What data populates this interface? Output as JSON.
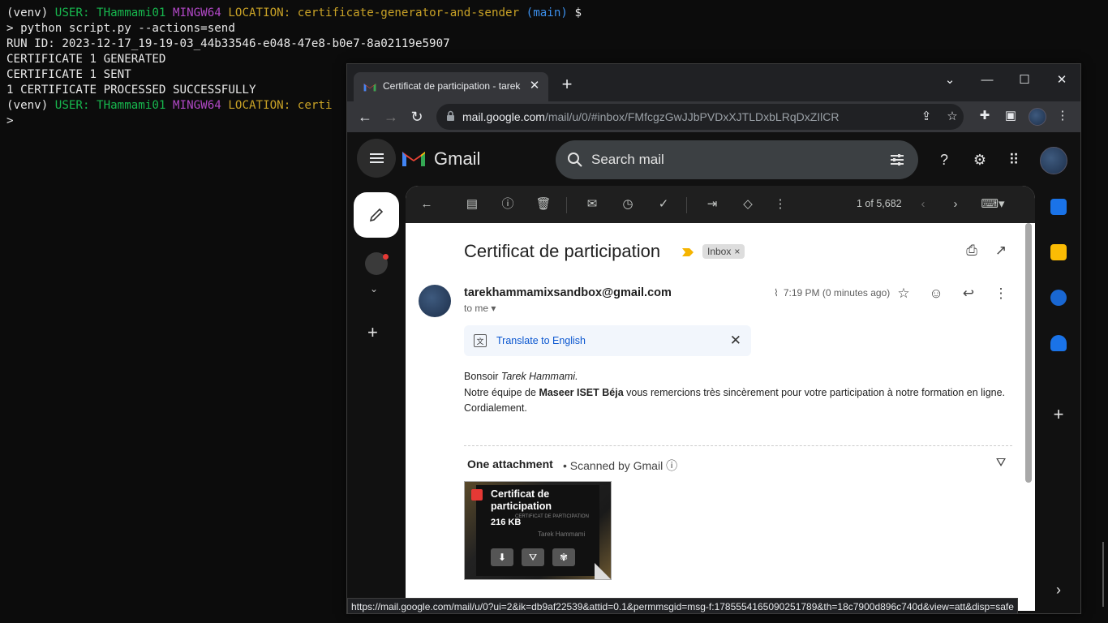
{
  "terminal": {
    "line1": {
      "prefix": "(venv) ",
      "user_label": "USER: THammami01 ",
      "env": "MINGW64 ",
      "loc_label": "LOCATION: ",
      "location": "certificate-generator-and-sender",
      "branch": " (main)",
      "prompt": " $"
    },
    "line2": "> python script.py --actions=send",
    "line3": "RUN ID: 2023-12-17_19-19-03_44b33546-e048-47e8-b0e7-8a02119e5907",
    "line4": "CERTIFICATE 1 GENERATED",
    "line5": "CERTIFICATE 1 SENT",
    "line6": "1 CERTIFICATE PROCESSED SUCCESSFULLY",
    "line7": {
      "prefix": "(venv) ",
      "user_label": "USER: THammami01 ",
      "env": "MINGW64 ",
      "loc_label": "LOCATION: ",
      "location": "certi"
    },
    "line8": ">"
  },
  "browser": {
    "tab_title": "Certificat de participation - tarek",
    "url_domain": "mail.google.com",
    "url_path": "/mail/u/0/#inbox/FMfcgzGwJJbPVDxXJTLDxbLRqDxZIlCR",
    "status_url": "https://mail.google.com/mail/u/0?ui=2&ik=db9af22539&attid=0.1&permmsgid=msg-f:1785554165090251789&th=18c7900d896c740d&view=att&disp=safe"
  },
  "gmail": {
    "app_name": "Gmail",
    "search_placeholder": "Search mail",
    "pager": "1 of 5,682",
    "subject": "Certificat de participation",
    "label_chip": "Inbox",
    "sender": "tarekhammamixsandbox@gmail.com",
    "to_me": "to me",
    "time": "7:19 PM (0 minutes ago)",
    "translate_link": "Translate to English",
    "body": {
      "greeting_prefix": "Bonsoir ",
      "greeting_name": "Tarek Hammami.",
      "line2_prefix": "Notre équipe de ",
      "line2_bold": "Maseer ISET Béja",
      "line2_rest": " vous remercions très sincèrement pour votre participation à notre formation en ligne.",
      "closing": "Cordialement."
    },
    "attachment_header": "One attachment",
    "scanned": "Scanned by Gmail",
    "attachment": {
      "name": "Certificat de participation",
      "size": "216 KB",
      "preview_heading": "CERTIFICAT DE PARTICIPATION",
      "preview_name": "Tarek Hammami"
    }
  },
  "colors": {
    "terminal_green": "#17b84e",
    "terminal_purple": "#b148c6",
    "terminal_yellow": "#c9a226",
    "terminal_blue": "#3b8eea",
    "gmail_link": "#0b57d0"
  }
}
